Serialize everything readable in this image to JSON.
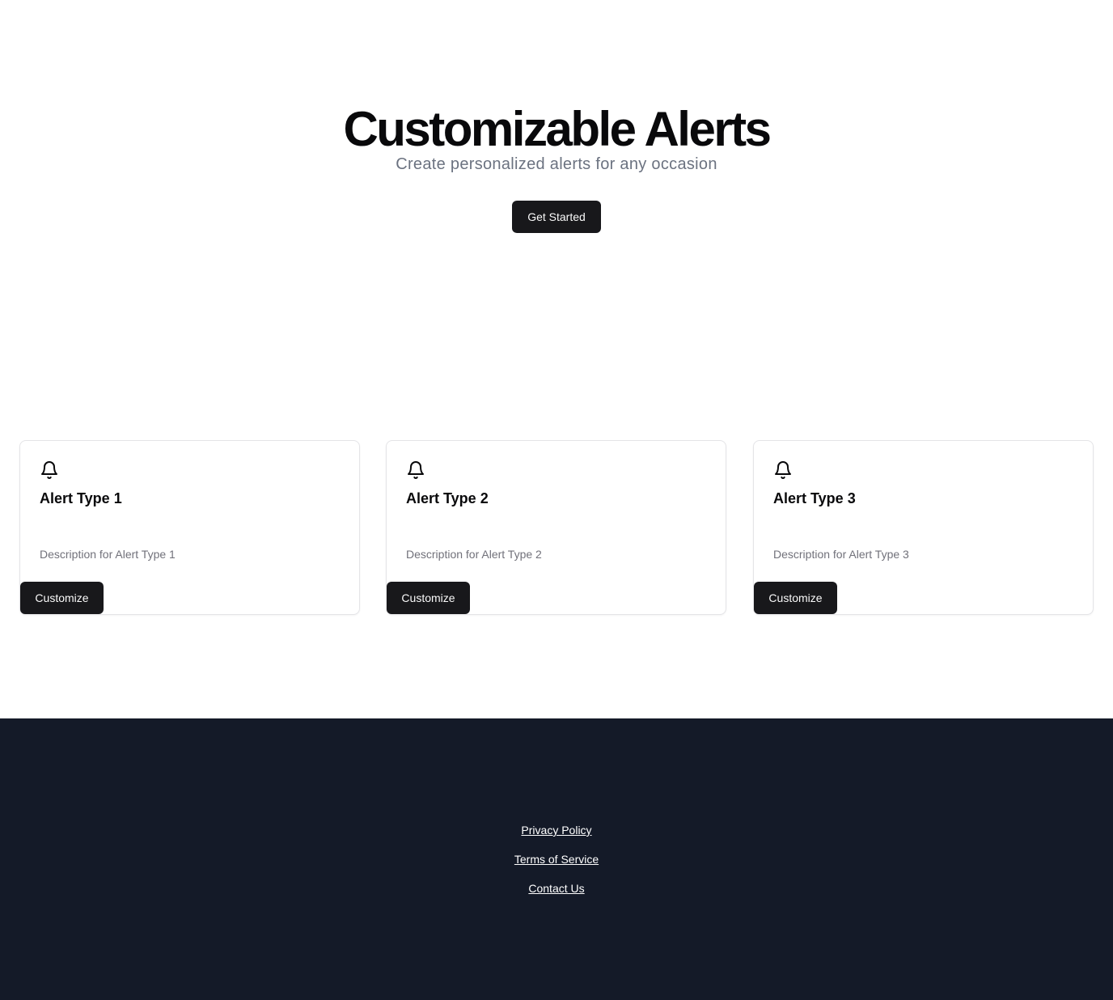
{
  "hero": {
    "title": "Customizable Alerts",
    "subtitle": "Create personalized alerts for any occasion",
    "cta_label": "Get Started"
  },
  "cards": [
    {
      "icon": "bell-icon",
      "title": "Alert Type 1",
      "description": "Description for Alert Type 1",
      "button_label": "Customize"
    },
    {
      "icon": "bell-icon",
      "title": "Alert Type 2",
      "description": "Description for Alert Type 2",
      "button_label": "Customize"
    },
    {
      "icon": "bell-icon",
      "title": "Alert Type 3",
      "description": "Description for Alert Type 3",
      "button_label": "Customize"
    }
  ],
  "footer": {
    "links": [
      "Privacy Policy",
      "Terms of Service",
      "Contact Us"
    ]
  },
  "colors": {
    "primary_button": "#18181b",
    "footer_background": "#141a28",
    "muted_text": "#71717a"
  }
}
